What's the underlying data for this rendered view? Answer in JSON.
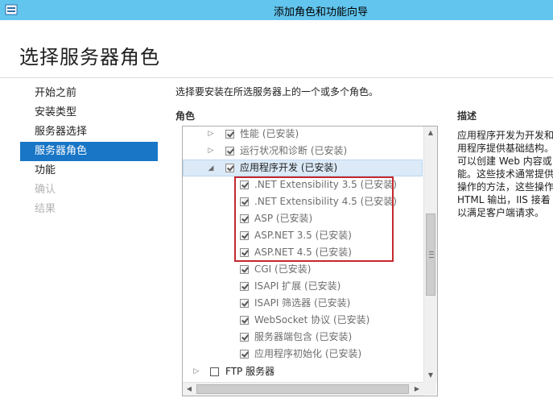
{
  "window": {
    "title": "添加角色和功能向导"
  },
  "page": {
    "title": "选择服务器角色"
  },
  "nav": {
    "items": [
      {
        "label": "开始之前",
        "state": "normal"
      },
      {
        "label": "安装类型",
        "state": "normal"
      },
      {
        "label": "服务器选择",
        "state": "normal"
      },
      {
        "label": "服务器角色",
        "state": "active"
      },
      {
        "label": "功能",
        "state": "normal"
      },
      {
        "label": "确认",
        "state": "disabled"
      },
      {
        "label": "结果",
        "state": "disabled"
      }
    ]
  },
  "main": {
    "instruction": "选择要安装在所选服务器上的一个或多个角色。",
    "roles_label": "角色",
    "description_label": "描述",
    "description_lines": [
      "应用程序开发为开发和",
      "用程序提供基础结构。",
      "可以创建 Web 内容或",
      "能。这些技术通常提供",
      "操作的方法，这些操作",
      "HTML 输出，IIS 接着",
      "以满足客户端请求。"
    ]
  },
  "tree": {
    "rows": [
      {
        "label": "性能 (已安装)",
        "arrow": "right",
        "checked": true,
        "level": 1
      },
      {
        "label": "运行状况和诊断 (已安装)",
        "arrow": "right",
        "checked": true,
        "level": 1
      },
      {
        "label": "应用程序开发 (已安装)",
        "arrow": "down",
        "checked": true,
        "level": 1
      },
      {
        "label": ".NET Extensibility 3.5 (已安装)",
        "arrow": "",
        "checked": true,
        "level": 2
      },
      {
        "label": ".NET Extensibility 4.5 (已安装)",
        "arrow": "",
        "checked": true,
        "level": 2
      },
      {
        "label": "ASP (已安装)",
        "arrow": "",
        "checked": true,
        "level": 2
      },
      {
        "label": "ASP.NET 3.5 (已安装)",
        "arrow": "",
        "checked": true,
        "level": 2
      },
      {
        "label": "ASP.NET 4.5 (已安装)",
        "arrow": "",
        "checked": true,
        "level": 2
      },
      {
        "label": "CGI (已安装)",
        "arrow": "",
        "checked": true,
        "level": 2
      },
      {
        "label": "ISAPI 扩展 (已安装)",
        "arrow": "",
        "checked": true,
        "level": 2
      },
      {
        "label": "ISAPI 筛选器 (已安装)",
        "arrow": "",
        "checked": true,
        "level": 2
      },
      {
        "label": "WebSocket 协议 (已安装)",
        "arrow": "",
        "checked": true,
        "level": 2
      },
      {
        "label": "服务器端包含 (已安装)",
        "arrow": "",
        "checked": true,
        "level": 2
      },
      {
        "label": "应用程序初始化 (已安装)",
        "arrow": "",
        "checked": true,
        "level": 2
      },
      {
        "label": "FTP 服务器",
        "arrow": "right",
        "checked": false,
        "level": 0
      }
    ]
  },
  "icons": {
    "app": "server-manager-icon",
    "expand": "triangle-right-icon",
    "collapse": "triangle-down-icon",
    "scroll_up": "scroll-up-icon",
    "scroll_down": "scroll-down-icon",
    "scroll_left": "scroll-left-icon",
    "scroll_right": "scroll-right-icon"
  },
  "colors": {
    "titlebar": "#62c5ee",
    "nav_active": "#1976c6",
    "selection": "#dceaf8",
    "callout": "#c3282f"
  }
}
